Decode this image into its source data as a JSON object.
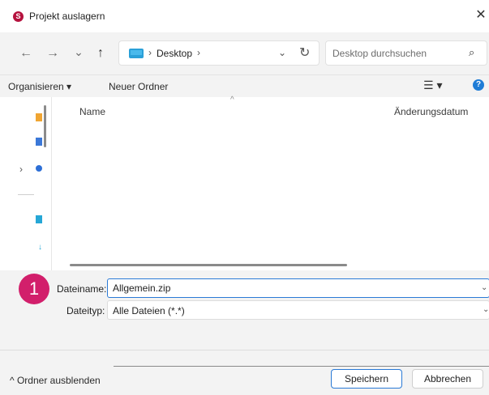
{
  "window": {
    "title": "Projekt auslagern",
    "close_glyph": "✕"
  },
  "nav": {
    "back_glyph": "←",
    "forward_glyph": "→",
    "recent_glyph": "⌄",
    "up_glyph": "↑",
    "breadcrumb_sep": "›",
    "location": "Desktop",
    "dropdown_glyph": "⌄",
    "refresh_glyph": "↻"
  },
  "search": {
    "placeholder": "Desktop durchsuchen",
    "icon_glyph": "⌕"
  },
  "toolbar": {
    "organize_label": "Organisieren ▾",
    "new_folder_label": "Neuer Ordner",
    "view_glyph": "☰ ▾",
    "help_glyph": "?"
  },
  "nav_pane": {
    "expand_glyph": "›",
    "downloads_glyph": "↓"
  },
  "file_list": {
    "columns": [
      "Name",
      "Änderungsdatum"
    ],
    "sort_glyph": "^"
  },
  "form": {
    "step_number": "1",
    "filename_label": "Dateiname:",
    "filename_value": "Allgemein.zip",
    "filetype_label": "Dateityp:",
    "filetype_value": "Alle Dateien (*.*)",
    "dropdown_glyph": "⌄"
  },
  "footer": {
    "hide_folders_label": "^ Ordner ausblenden",
    "save_label": "Speichern",
    "cancel_label": "Abbrechen"
  },
  "colors": {
    "accent": "#2a7ad6",
    "badge": "#d21f6b",
    "app_icon": "#b5123e"
  }
}
